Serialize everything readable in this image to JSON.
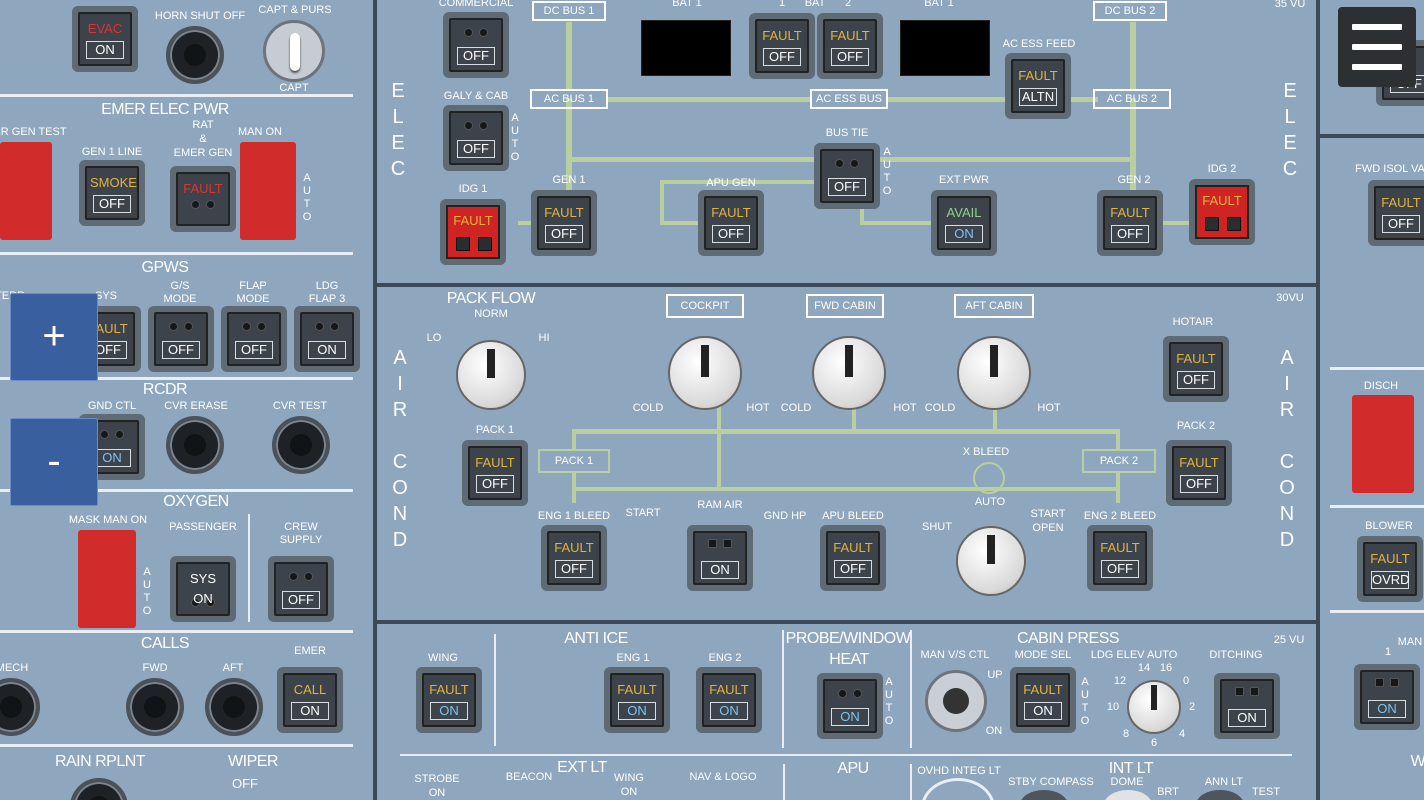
{
  "overhead": {
    "left": {
      "evac_top": "EVAC",
      "evac_bot": "ON",
      "horn_shut_off": "HORN SHUT OFF",
      "capt_purs": "CAPT & PURS",
      "capt": "CAPT",
      "emer_elec_pwr": "EMER ELEC PWR",
      "emer_gen_test": "ER GEN TEST",
      "gen1_line": "GEN 1 LINE",
      "gen1_line_top": "SMOKE",
      "gen1_line_bot": "OFF",
      "rat_emer_gen": "RAT\n&\nEMER GEN",
      "rat_fault": "FAULT",
      "man_on": "MAN ON",
      "auto": "AUTO",
      "gpws": "GPWS",
      "terr": "TERR",
      "sys": "SYS",
      "sys_top": "FAULT",
      "sys_bot": "OFF",
      "gs_mode": "G/S\nMODE",
      "gs_mode_bot": "OFF",
      "flap_mode": "FLAP\nMODE",
      "flap_mode_bot": "OFF",
      "ldg_flap3": "LDG\nFLAP 3",
      "ldg_flap3_bot": "ON",
      "rcdr": "RCDR",
      "gnd_ctl": "GND CTL",
      "gnd_ctl_bot": "ON",
      "cvr_erase": "CVR ERASE",
      "cvr_test": "CVR TEST",
      "oxygen": "OXYGEN",
      "mask_man_on": "MASK MAN ON",
      "passenger": "PASSENGER",
      "passenger_top": "SYS ON",
      "crew_supply": "CREW\nSUPPLY",
      "crew_supply_bot": "OFF",
      "calls": "CALLS",
      "mech": "MECH",
      "fwd": "FWD",
      "aft": "AFT",
      "emer": "EMER",
      "emer_top": "CALL",
      "emer_bot": "ON",
      "rain_rplnt": "RAIN RPLNT",
      "wiper": "WIPER",
      "wiper_off": "OFF"
    },
    "elec": {
      "side_label": "ELEC",
      "vu": "35 VU",
      "commercial": "COMMERCIAL",
      "commercial_bot": "OFF",
      "galy_cab": "GALY & CAB",
      "galy_cab_bot": "OFF",
      "dc_bus_1": "DC BUS 1",
      "dc_bus_2": "DC BUS 2",
      "bat1_left": "BAT 1",
      "bat": "BAT",
      "bat_1": "1",
      "bat_2": "2",
      "bat_fault": "FAULT",
      "bat_off": "OFF",
      "bat1_right": "BAT 1",
      "ac_ess_feed": "AC ESS FEED",
      "ac_ess_feed_top": "FAULT",
      "ac_ess_feed_bot": "ALTN",
      "ac_bus_1": "AC BUS 1",
      "ac_bus_2": "AC BUS 2",
      "ac_ess_bus": "AC ESS BUS",
      "bus_tie": "BUS TIE",
      "bus_tie_bot": "OFF",
      "idg1": "IDG 1",
      "idg2": "IDG 2",
      "idg_fault": "FAULT",
      "gen1": "GEN 1",
      "apu_gen": "APU GEN",
      "ext_pwr": "EXT PWR",
      "ext_top": "AVAIL",
      "ext_bot": "ON",
      "gen2": "GEN 2",
      "fault": "FAULT",
      "off": "OFF",
      "auto": "AUTO"
    },
    "air": {
      "side_label": "AIR COND",
      "vu": "30VU",
      "pack_flow": "PACK FLOW",
      "norm": "NORM",
      "lo": "LO",
      "hi": "HI",
      "cockpit": "COCKPIT",
      "fwd_cabin": "FWD CABIN",
      "aft_cabin": "AFT CABIN",
      "cold": "COLD",
      "hot": "HOT",
      "hotair": "HOTAIR",
      "pack1": "PACK 1",
      "pack2": "PACK 2",
      "x_bleed": "X BLEED",
      "shut": "SHUT",
      "auto": "AUTO",
      "open": "START\nOPEN",
      "eng1_bleed": "ENG 1 BLEED",
      "eng2_bleed": "ENG 2 BLEED",
      "ram_air": "RAM AIR",
      "ram_air_bot": "ON",
      "start": "START",
      "gnd_hp": "GND HP",
      "apu_bleed": "APU BLEED",
      "fault": "FAULT",
      "off": "OFF"
    },
    "bottom": {
      "vu": "25 VU",
      "anti_ice": "ANTI ICE",
      "wing": "WING",
      "eng1": "ENG 1",
      "eng2": "ENG 2",
      "probe_window": "PROBE/WINDOW",
      "heat": "HEAT",
      "cabin_press": "CABIN PRESS",
      "man_vs_ctl": "MAN V/S CTL",
      "up": "UP",
      "dn": "ON",
      "mode_sel": "MODE SEL",
      "ldg_elev": "LDG ELEV AUTO",
      "ditching": "DITCHING",
      "ditching_bot": "ON",
      "fault": "FAULT",
      "on": "ON",
      "auto": "AUTO",
      "ext_lt": "EXT LT",
      "strobe": "STROBE\nON",
      "beacon": "BEACON",
      "wing_lt": "WING\nON",
      "nav_logo": "NAV & LOGO",
      "apu": "APU",
      "ovhd_integ_lt": "OVHD INTEG LT",
      "stby_compass": "STBY COMPASS",
      "int_lt": "INT LT",
      "dome": "DOME",
      "brt": "BRT",
      "ann_lt": "ANN LT",
      "test": "TEST",
      "dial_nums": [
        "14",
        "16",
        "12",
        "0",
        "10",
        "2",
        "8",
        "4",
        "6"
      ]
    },
    "right": {
      "fwd_isol_valve": "FWD ISOL VA",
      "fwd_top": "FAULT",
      "fwd_bot": "OFF",
      "disch": "DISCH",
      "blower": "BLOWER",
      "blower_top": "FAULT",
      "blower_bot": "OVRD",
      "man": "MAN",
      "one": "1",
      "on": "ON",
      "w": "W"
    }
  },
  "controls": {
    "zoom_in": "+",
    "zoom_out": "-"
  }
}
